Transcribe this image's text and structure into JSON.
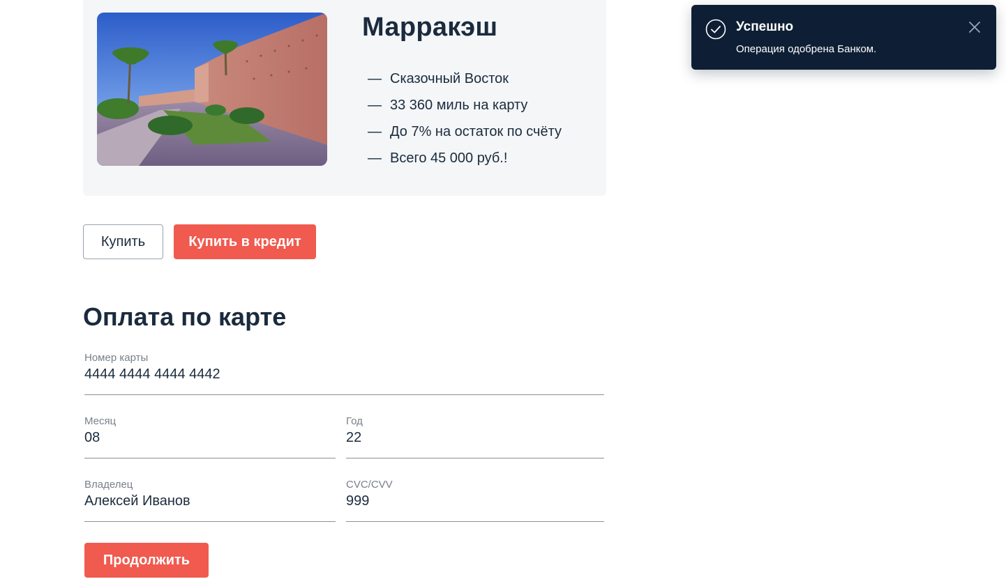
{
  "offer": {
    "title": "Марракэш",
    "image_alt": "Стены Марракеша",
    "dash": "—",
    "features": [
      "Сказочный Восток",
      "33 360 миль на карту",
      "До 7% на остаток по счёту",
      "Всего 45 000 руб.!"
    ]
  },
  "actions": {
    "buy_label": "Купить",
    "buy_credit_label": "Купить в кредит"
  },
  "payment_form": {
    "title": "Оплата по карте",
    "card_number": {
      "label": "Номер карты",
      "value": "4444 4444 4444 4442"
    },
    "month": {
      "label": "Месяц",
      "value": "08"
    },
    "year": {
      "label": "Год",
      "value": "22"
    },
    "owner": {
      "label": "Владелец",
      "value": "Алексей Иванов"
    },
    "cvc": {
      "label": "CVC/CVV",
      "value": "999"
    },
    "continue_label": "Продолжить"
  },
  "notification": {
    "title": "Успешно",
    "message": "Операция одобрена Банком.",
    "icon": "check-circle-icon",
    "close_icon": "close-icon"
  },
  "colors": {
    "accent": "#f05a4f",
    "text": "#1b2b3d",
    "toast_bg": "#0e1f35",
    "card_bg": "#f4f6f8"
  }
}
